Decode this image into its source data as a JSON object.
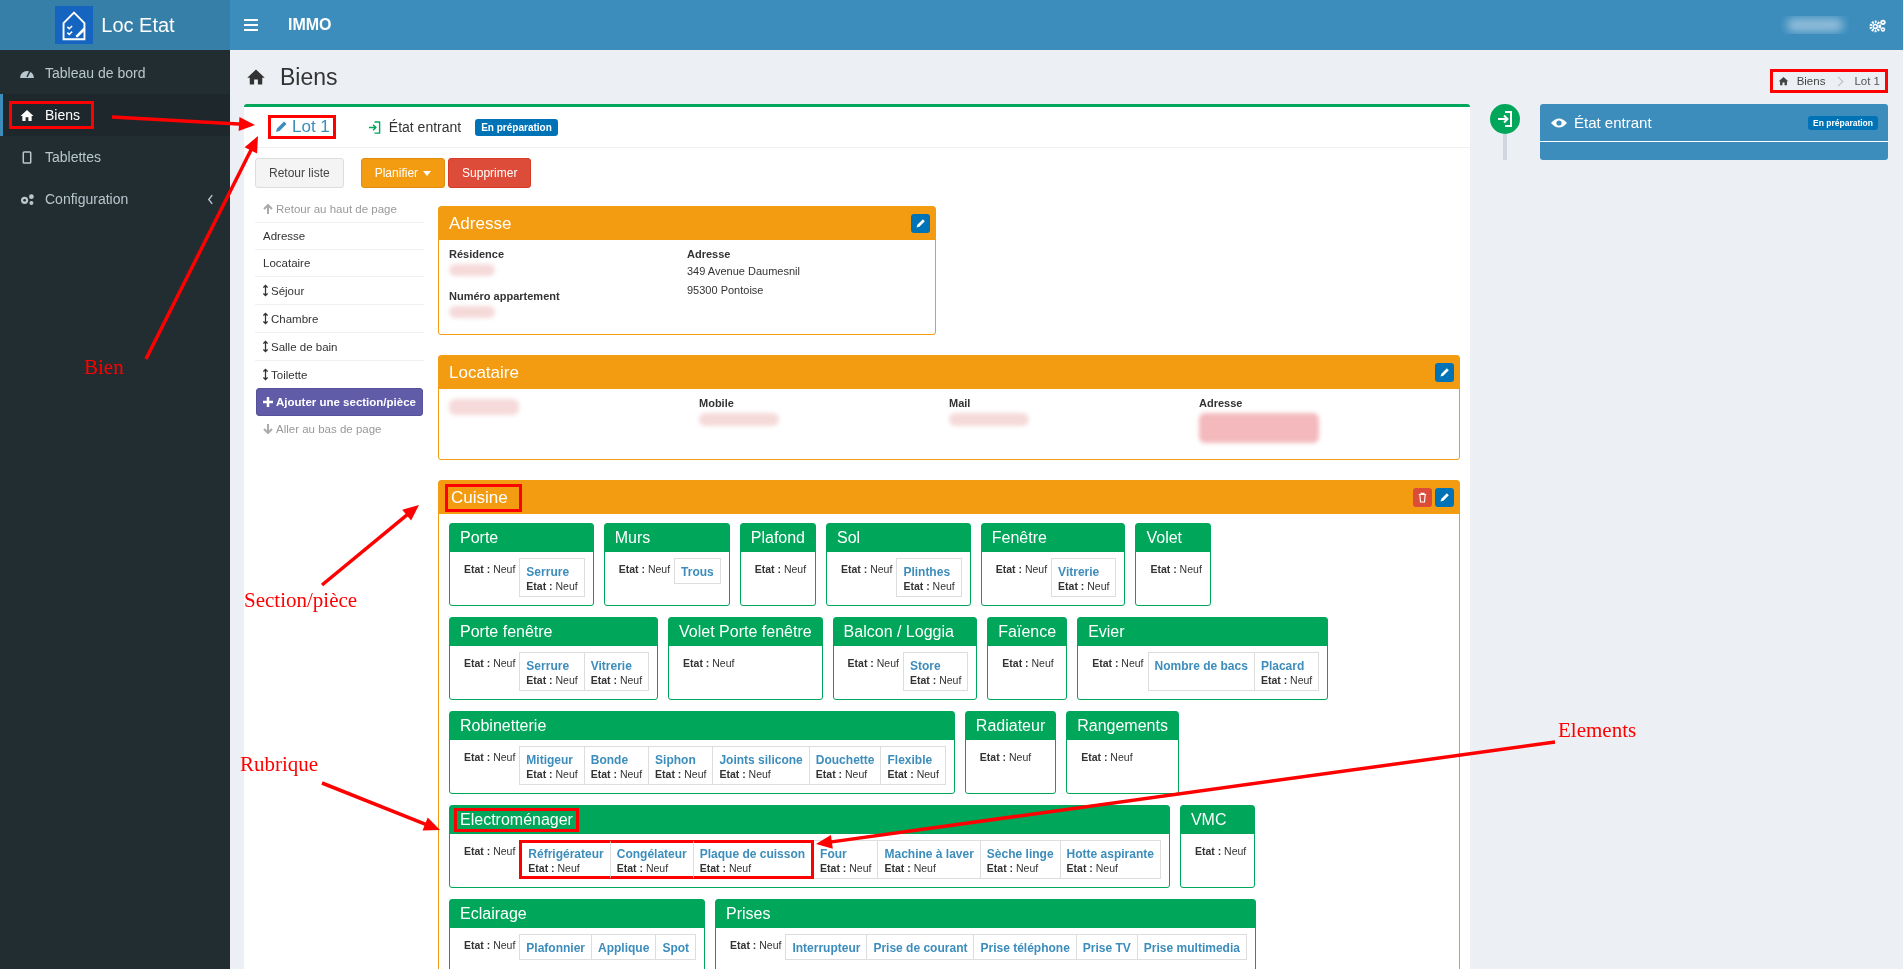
{
  "brand": {
    "name": "Loc Etat"
  },
  "topbar": {
    "title": "IMMO"
  },
  "sidebar": {
    "items": [
      {
        "label": "Tableau de bord",
        "selected": false,
        "expandable": false,
        "highlighted": false
      },
      {
        "label": "Biens",
        "selected": true,
        "expandable": false,
        "highlighted": true
      },
      {
        "label": "Tablettes",
        "selected": false,
        "expandable": false,
        "highlighted": false
      },
      {
        "label": "Configuration",
        "selected": false,
        "expandable": true,
        "highlighted": false
      }
    ]
  },
  "page": {
    "title": "Biens",
    "breadcrumb": {
      "highlighted": true,
      "items": [
        "Biens",
        "Lot 1"
      ]
    }
  },
  "lot": {
    "title": "Lot 1",
    "highlighted": true,
    "state_label": "État entrant",
    "badge": "En préparation",
    "buttons": [
      {
        "label": "Retour liste",
        "kind": "default",
        "dropdown": false
      },
      {
        "label": "Planifier",
        "kind": "warning",
        "dropdown": true
      },
      {
        "label": "Supprimer",
        "kind": "danger",
        "dropdown": false
      }
    ]
  },
  "nav": {
    "top_link": "Retour au haut de page",
    "items": [
      {
        "label": "Adresse",
        "kind": "anchor"
      },
      {
        "label": "Locataire",
        "kind": "anchor"
      },
      {
        "label": "Séjour",
        "kind": "section"
      },
      {
        "label": "Chambre",
        "kind": "section"
      },
      {
        "label": "Salle de bain",
        "kind": "section"
      },
      {
        "label": "Toilette",
        "kind": "section"
      }
    ],
    "add_button": "Ajouter une section/pièce",
    "bottom_link": "Aller au bas de page"
  },
  "adresse": {
    "title": "Adresse",
    "columns": [
      [
        {
          "label": "Résidence",
          "redacted": true
        },
        {
          "label": "Numéro appartement",
          "redacted": true
        }
      ],
      [
        {
          "label": "Adresse",
          "lines": [
            "349 Avenue Daumesnil",
            "95300 Pontoise"
          ]
        }
      ]
    ]
  },
  "locataire": {
    "title": "Locataire",
    "fields": [
      {
        "redacted": true
      },
      {
        "label": "Mobile",
        "redacted": true
      },
      {
        "label": "Mail",
        "redacted": true
      },
      {
        "label": "Adresse",
        "redacted": true
      }
    ]
  },
  "section": {
    "title": "Cuisine",
    "highlighted": true,
    "rubrique_rows": [
      [
        {
          "title": "Porte",
          "highlighted": false,
          "etat": "**Etat :** Neuf",
          "elements": [
            {
              "name": "Serrure",
              "etat": "**Etat :** Neuf",
              "highlighted": false
            }
          ]
        },
        {
          "title": "Murs",
          "highlighted": false,
          "etat": "**Etat :** Neuf",
          "elements": [
            {
              "name": "Trous",
              "highlighted": false
            }
          ]
        },
        {
          "title": "Plafond",
          "highlighted": false,
          "etat": "**Etat :** Neuf"
        },
        {
          "title": "Sol",
          "highlighted": false,
          "etat": "**Etat :** Neuf",
          "elements": [
            {
              "name": "Plinthes",
              "etat": "**Etat :** Neuf",
              "highlighted": false
            }
          ]
        },
        {
          "title": "Fenêtre",
          "highlighted": false,
          "etat": "**Etat :** Neuf",
          "elements": [
            {
              "name": "Vitrerie",
              "etat": "**Etat :** Neuf",
              "highlighted": false
            }
          ]
        },
        {
          "title": "Volet",
          "highlighted": false,
          "etat": "**Etat :** Neuf"
        }
      ],
      [
        {
          "title": "Porte fenêtre",
          "highlighted": false,
          "etat": "**Etat :** Neuf",
          "elements": [
            {
              "name": "Serrure",
              "etat": "**Etat :** Neuf",
              "highlighted": false
            },
            {
              "name": "Vitrerie",
              "etat": "**Etat :** Neuf",
              "highlighted": false
            }
          ]
        },
        {
          "title": "Volet Porte fenêtre",
          "highlighted": false,
          "etat": "**Etat :** Neuf"
        },
        {
          "title": "Balcon / Loggia",
          "highlighted": false,
          "etat": "**Etat :** Neuf",
          "elements": [
            {
              "name": "Store",
              "etat": "**Etat :** Neuf",
              "highlighted": false
            }
          ]
        },
        {
          "title": "Faïence",
          "highlighted": false,
          "etat": "**Etat :** Neuf"
        },
        {
          "title": "Evier",
          "highlighted": false,
          "etat": "**Etat :** Neuf",
          "elements": [
            {
              "name": "Nombre de bacs",
              "highlighted": false
            },
            {
              "name": "Placard",
              "etat": "**Etat :** Neuf",
              "highlighted": false
            }
          ]
        }
      ],
      [
        {
          "title": "Robinetterie",
          "highlighted": false,
          "etat": "**Etat :** Neuf",
          "elements": [
            {
              "name": "Mitigeur",
              "etat": "**Etat :** Neuf",
              "highlighted": false
            },
            {
              "name": "Bonde",
              "etat": "**Etat :** Neuf",
              "highlighted": false
            },
            {
              "name": "Siphon",
              "etat": "**Etat :** Neuf",
              "highlighted": false
            },
            {
              "name": "Joints silicone",
              "etat": "**Etat :** Neuf",
              "highlighted": false
            },
            {
              "name": "Douchette",
              "etat": "**Etat :** Neuf",
              "highlighted": false
            },
            {
              "name": "Flexible",
              "etat": "**Etat :** Neuf",
              "highlighted": false
            }
          ]
        },
        {
          "title": "Radiateur",
          "highlighted": false,
          "etat": "**Etat :** Neuf"
        },
        {
          "title": "Rangements",
          "highlighted": false,
          "etat": "**Etat :** Neuf"
        }
      ],
      [
        {
          "title": "Electroménager",
          "highlighted": true,
          "etat": "**Etat :** Neuf",
          "elements": [
            {
              "name": "Réfrigérateur",
              "etat": "**Etat :** Neuf",
              "highlighted": true
            },
            {
              "name": "Congélateur",
              "etat": "**Etat :** Neuf",
              "highlighted": true
            },
            {
              "name": "Plaque de cuisson",
              "etat": "**Etat :** Neuf",
              "highlighted": true
            },
            {
              "name": "Four",
              "etat": "**Etat :** Neuf",
              "highlighted": false
            },
            {
              "name": "Machine à laver",
              "etat": "**Etat :** Neuf",
              "highlighted": false
            },
            {
              "name": "Sèche linge",
              "etat": "**Etat :** Neuf",
              "highlighted": false
            },
            {
              "name": "Hotte aspirante",
              "etat": "**Etat :** Neuf",
              "highlighted": false
            }
          ]
        },
        {
          "title": "VMC",
          "highlighted": false,
          "etat": "**Etat :** Neuf"
        }
      ],
      [
        {
          "title": "Eclairage",
          "highlighted": false,
          "etat": "**Etat :** Neuf",
          "elements": [
            {
              "name": "Plafonnier",
              "highlighted": false
            },
            {
              "name": "Applique",
              "highlighted": false
            },
            {
              "name": "Spot",
              "highlighted": false
            }
          ]
        },
        {
          "title": "Prises",
          "highlighted": false,
          "etat": "**Etat :** Neuf",
          "elements": [
            {
              "name": "Interrupteur",
              "highlighted": false
            },
            {
              "name": "Prise de courant",
              "highlighted": false
            },
            {
              "name": "Prise téléphone",
              "highlighted": false
            },
            {
              "name": "Prise TV",
              "highlighted": false
            },
            {
              "name": "Prise multimedia",
              "highlighted": false
            }
          ]
        }
      ]
    ]
  },
  "timeline": {
    "title": "État entrant",
    "badge": "En préparation"
  },
  "annotations": [
    {
      "label": "Bien"
    },
    {
      "label": "Section/pièce"
    },
    {
      "label": "Rubrique"
    },
    {
      "label": "Elements"
    }
  ]
}
